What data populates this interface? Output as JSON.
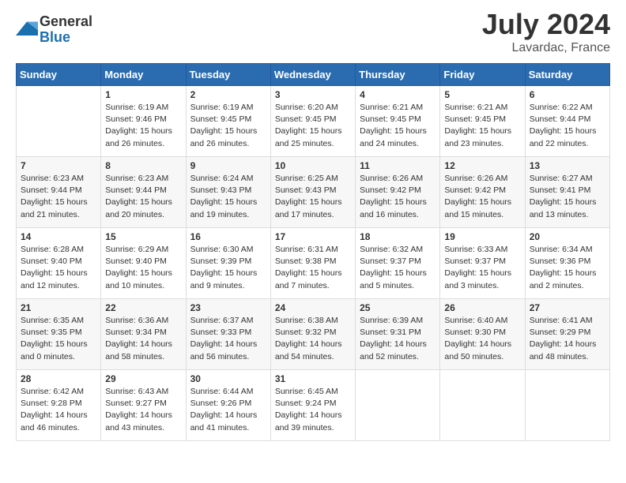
{
  "logo": {
    "general": "General",
    "blue": "Blue"
  },
  "title": "July 2024",
  "location": "Lavardac, France",
  "days_of_week": [
    "Sunday",
    "Monday",
    "Tuesday",
    "Wednesday",
    "Thursday",
    "Friday",
    "Saturday"
  ],
  "weeks": [
    [
      {
        "day": "",
        "info": ""
      },
      {
        "day": "1",
        "info": "Sunrise: 6:19 AM\nSunset: 9:46 PM\nDaylight: 15 hours\nand 26 minutes."
      },
      {
        "day": "2",
        "info": "Sunrise: 6:19 AM\nSunset: 9:45 PM\nDaylight: 15 hours\nand 26 minutes."
      },
      {
        "day": "3",
        "info": "Sunrise: 6:20 AM\nSunset: 9:45 PM\nDaylight: 15 hours\nand 25 minutes."
      },
      {
        "day": "4",
        "info": "Sunrise: 6:21 AM\nSunset: 9:45 PM\nDaylight: 15 hours\nand 24 minutes."
      },
      {
        "day": "5",
        "info": "Sunrise: 6:21 AM\nSunset: 9:45 PM\nDaylight: 15 hours\nand 23 minutes."
      },
      {
        "day": "6",
        "info": "Sunrise: 6:22 AM\nSunset: 9:44 PM\nDaylight: 15 hours\nand 22 minutes."
      }
    ],
    [
      {
        "day": "7",
        "info": "Sunrise: 6:23 AM\nSunset: 9:44 PM\nDaylight: 15 hours\nand 21 minutes."
      },
      {
        "day": "8",
        "info": "Sunrise: 6:23 AM\nSunset: 9:44 PM\nDaylight: 15 hours\nand 20 minutes."
      },
      {
        "day": "9",
        "info": "Sunrise: 6:24 AM\nSunset: 9:43 PM\nDaylight: 15 hours\nand 19 minutes."
      },
      {
        "day": "10",
        "info": "Sunrise: 6:25 AM\nSunset: 9:43 PM\nDaylight: 15 hours\nand 17 minutes."
      },
      {
        "day": "11",
        "info": "Sunrise: 6:26 AM\nSunset: 9:42 PM\nDaylight: 15 hours\nand 16 minutes."
      },
      {
        "day": "12",
        "info": "Sunrise: 6:26 AM\nSunset: 9:42 PM\nDaylight: 15 hours\nand 15 minutes."
      },
      {
        "day": "13",
        "info": "Sunrise: 6:27 AM\nSunset: 9:41 PM\nDaylight: 15 hours\nand 13 minutes."
      }
    ],
    [
      {
        "day": "14",
        "info": "Sunrise: 6:28 AM\nSunset: 9:40 PM\nDaylight: 15 hours\nand 12 minutes."
      },
      {
        "day": "15",
        "info": "Sunrise: 6:29 AM\nSunset: 9:40 PM\nDaylight: 15 hours\nand 10 minutes."
      },
      {
        "day": "16",
        "info": "Sunrise: 6:30 AM\nSunset: 9:39 PM\nDaylight: 15 hours\nand 9 minutes."
      },
      {
        "day": "17",
        "info": "Sunrise: 6:31 AM\nSunset: 9:38 PM\nDaylight: 15 hours\nand 7 minutes."
      },
      {
        "day": "18",
        "info": "Sunrise: 6:32 AM\nSunset: 9:37 PM\nDaylight: 15 hours\nand 5 minutes."
      },
      {
        "day": "19",
        "info": "Sunrise: 6:33 AM\nSunset: 9:37 PM\nDaylight: 15 hours\nand 3 minutes."
      },
      {
        "day": "20",
        "info": "Sunrise: 6:34 AM\nSunset: 9:36 PM\nDaylight: 15 hours\nand 2 minutes."
      }
    ],
    [
      {
        "day": "21",
        "info": "Sunrise: 6:35 AM\nSunset: 9:35 PM\nDaylight: 15 hours\nand 0 minutes."
      },
      {
        "day": "22",
        "info": "Sunrise: 6:36 AM\nSunset: 9:34 PM\nDaylight: 14 hours\nand 58 minutes."
      },
      {
        "day": "23",
        "info": "Sunrise: 6:37 AM\nSunset: 9:33 PM\nDaylight: 14 hours\nand 56 minutes."
      },
      {
        "day": "24",
        "info": "Sunrise: 6:38 AM\nSunset: 9:32 PM\nDaylight: 14 hours\nand 54 minutes."
      },
      {
        "day": "25",
        "info": "Sunrise: 6:39 AM\nSunset: 9:31 PM\nDaylight: 14 hours\nand 52 minutes."
      },
      {
        "day": "26",
        "info": "Sunrise: 6:40 AM\nSunset: 9:30 PM\nDaylight: 14 hours\nand 50 minutes."
      },
      {
        "day": "27",
        "info": "Sunrise: 6:41 AM\nSunset: 9:29 PM\nDaylight: 14 hours\nand 48 minutes."
      }
    ],
    [
      {
        "day": "28",
        "info": "Sunrise: 6:42 AM\nSunset: 9:28 PM\nDaylight: 14 hours\nand 46 minutes."
      },
      {
        "day": "29",
        "info": "Sunrise: 6:43 AM\nSunset: 9:27 PM\nDaylight: 14 hours\nand 43 minutes."
      },
      {
        "day": "30",
        "info": "Sunrise: 6:44 AM\nSunset: 9:26 PM\nDaylight: 14 hours\nand 41 minutes."
      },
      {
        "day": "31",
        "info": "Sunrise: 6:45 AM\nSunset: 9:24 PM\nDaylight: 14 hours\nand 39 minutes."
      },
      {
        "day": "",
        "info": ""
      },
      {
        "day": "",
        "info": ""
      },
      {
        "day": "",
        "info": ""
      }
    ]
  ]
}
